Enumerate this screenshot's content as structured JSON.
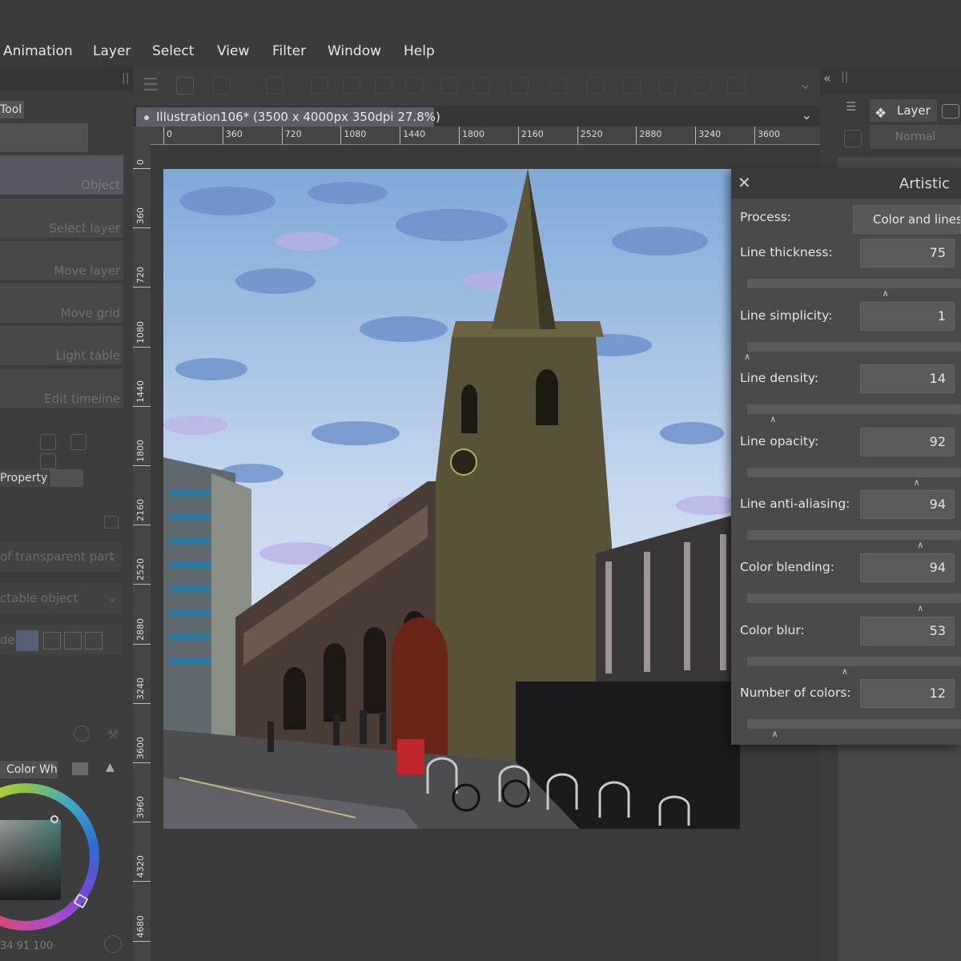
{
  "menu": {
    "items": [
      "Animation",
      "Layer",
      "Select",
      "View",
      "Filter",
      "Window",
      "Help"
    ]
  },
  "left_panel": {
    "tool_tab": "Tool",
    "subtools": [
      "Object",
      "Select layer",
      "Move layer",
      "Move grid",
      "Light table",
      "Edit timeline"
    ],
    "property_tab": "Property",
    "property_rows": [
      "of transparent part",
      "ctable object",
      "de"
    ],
    "color_tab": "Color Wh",
    "color_values": "34   91   100"
  },
  "document": {
    "tab_title": "Illustration106* (3500 x 4000px 350dpi 27.8%)"
  },
  "rulers": {
    "horizontal": [
      "0",
      "360",
      "720",
      "1080",
      "1440",
      "1800",
      "2160",
      "2520",
      "2880",
      "3240",
      "3600"
    ],
    "vertical": [
      "0",
      "360",
      "720",
      "1080",
      "1440",
      "1800",
      "2160",
      "2520",
      "2880",
      "3240",
      "3600",
      "3960",
      "4320",
      "4680"
    ]
  },
  "right_panel": {
    "layer_tab": "Layer",
    "blend_mode": "Normal"
  },
  "artistic": {
    "title": "Artistic",
    "process_label": "Process:",
    "process_value": "Color and lines",
    "params": [
      {
        "label": "Line thickness:",
        "value": "75",
        "fraction": 0.75
      },
      {
        "label": "Line simplicity:",
        "value": "1",
        "fraction": 0.0
      },
      {
        "label": "Line density:",
        "value": "14",
        "fraction": 0.14
      },
      {
        "label": "Line opacity:",
        "value": "92",
        "fraction": 0.92
      },
      {
        "label": "Line anti-aliasing:",
        "value": "94",
        "fraction": 0.94
      },
      {
        "label": "Color blending:",
        "value": "94",
        "fraction": 0.94
      },
      {
        "label": "Color blur:",
        "value": "53",
        "fraction": 0.53
      },
      {
        "label": "Number of colors:",
        "value": "12",
        "fraction": 0.15
      }
    ]
  },
  "colors": {
    "panel_bg": "#3e3e3e",
    "dialog_bg": "#4a4a4a",
    "tab_active": "#5d5d68"
  }
}
